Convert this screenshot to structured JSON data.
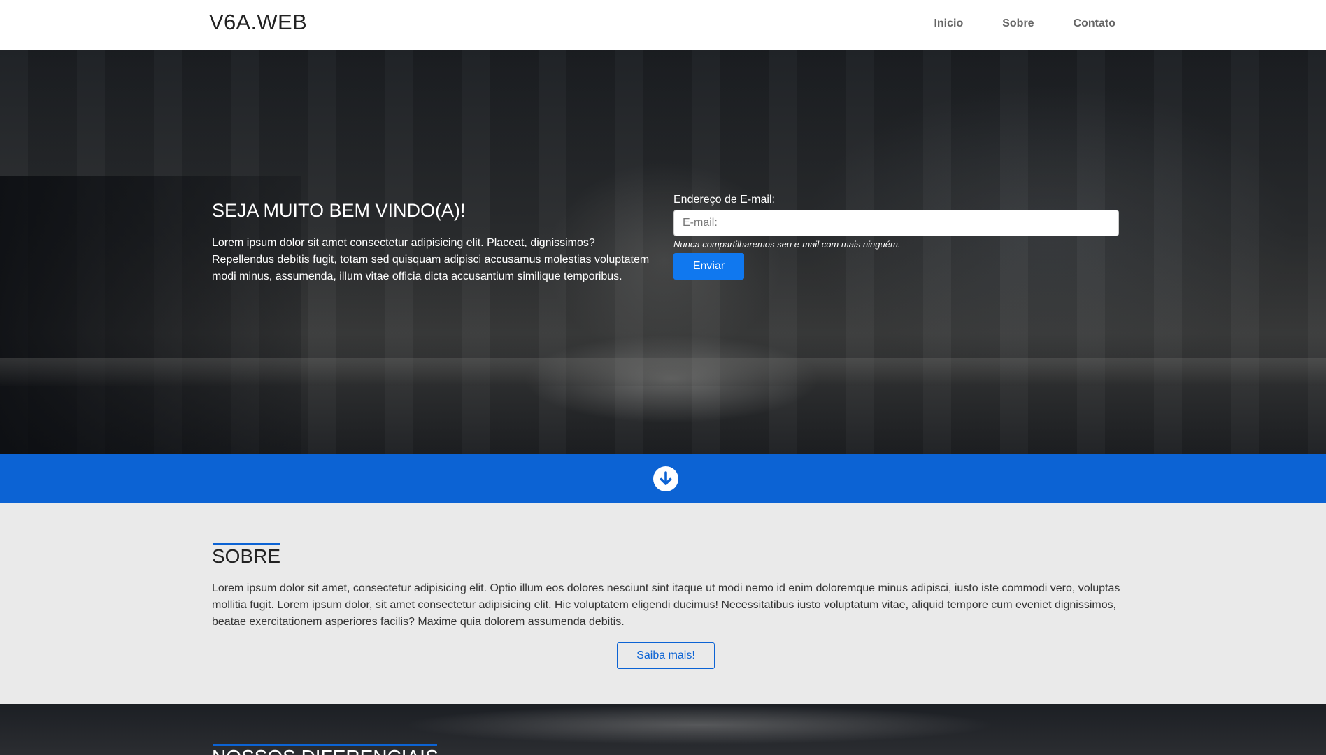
{
  "navbar": {
    "brand": "V6A.WEB",
    "links": [
      "Inicio",
      "Sobre",
      "Contato"
    ]
  },
  "hero": {
    "title": "SEJA MUITO BEM VINDO(A)!",
    "text": "Lorem ipsum dolor sit amet consectetur adipisicing elit. Placeat, dignissimos? Repellendus debitis fugit, totam sed quisquam adipisci accusamus molestias voluptatem modi minus, assumenda, illum vitae officia dicta accusantium similique temporibus.",
    "form": {
      "email_label": "Endereço de E-mail:",
      "email_placeholder": "E-mail:",
      "email_value": "",
      "help_text": "Nunca compartilharemos seu e-mail com mais ninguém.",
      "submit_label": "Enviar"
    }
  },
  "band": {
    "icon": "arrow-down-circle-icon",
    "color": "#0c63d4"
  },
  "about": {
    "title": "SOBRE",
    "text": "Lorem ipsum dolor sit amet, consectetur adipisicing elit. Optio illum eos dolores nesciunt sint itaque ut modi nemo id enim doloremque minus adipisci, iusto iste commodi vero, voluptas mollitia fugit. Lorem ipsum dolor, sit amet consectetur adipisicing elit. Hic voluptatem eligendi ducimus! Necessitatibus iusto voluptatum vitae, aliquid tempore cum eveniet dignissimos, beatae exercitationem asperiores facilis? Maxime quia dolorem assumenda debitis.",
    "button_label": "Saiba mais!"
  },
  "differentials": {
    "title": "NOSSOS DIFERENCIAIS"
  },
  "colors": {
    "accent": "#0c63d4",
    "button_primary": "#1078ef",
    "section_bg": "#eaeaea"
  }
}
